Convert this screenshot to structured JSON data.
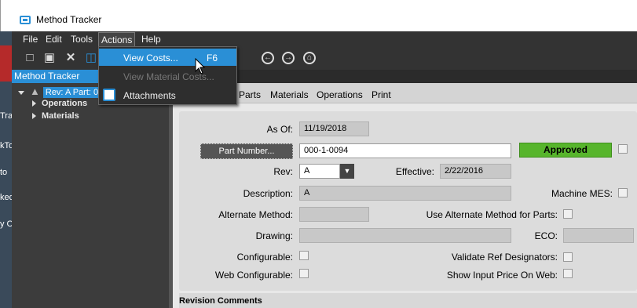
{
  "window": {
    "title": "Method Tracker"
  },
  "desktop_fragments": [
    "Tra",
    "kTo",
    "to",
    "ked",
    "y C"
  ],
  "menubar": {
    "items": [
      "File",
      "Edit",
      "Tools",
      "Actions",
      "Help"
    ]
  },
  "actions_menu": {
    "items": [
      {
        "label": "View Costs...",
        "shortcut": "F6",
        "state": "highlighted"
      },
      {
        "label": "View Material Costs...",
        "state": "disabled"
      },
      {
        "label": "Attachments",
        "state": "enabled"
      }
    ]
  },
  "toolbar": {
    "icons": [
      "new-icon",
      "save-icon",
      "delete-icon",
      "attach-icon",
      "back-icon",
      "forward-icon",
      "home-icon"
    ]
  },
  "tree": {
    "header": "Method Tracker",
    "root": "Rev: A Part: 0",
    "children": [
      "Operations",
      "Materials"
    ]
  },
  "tabs": [
    "Parts",
    "Materials",
    "Operations",
    "Print"
  ],
  "form": {
    "as_of_label": "As Of:",
    "as_of": "11/19/2018",
    "part_button": "Part Number...",
    "part_number": "000-1-0094",
    "status": "Approved",
    "rev_label": "Rev:",
    "rev": "A",
    "effective_label": "Effective:",
    "effective": "2/22/2016",
    "description_label": "Description:",
    "description": "A",
    "machine_mes_label": "Machine MES:",
    "alt_method_label": "Alternate Method:",
    "alt_method": "",
    "use_alt_label": "Use Alternate Method for Parts:",
    "drawing_label": "Drawing:",
    "drawing": "",
    "eco_label": "ECO:",
    "eco": "",
    "configurable_label": "Configurable:",
    "validate_label": "Validate Ref Designators:",
    "web_config_label": "Web Configurable:",
    "show_price_label": "Show Input Price On Web:"
  },
  "revision_comments": "Revision Comments",
  "colors": {
    "accent": "#2a8fd6",
    "approved": "#57b52c"
  }
}
